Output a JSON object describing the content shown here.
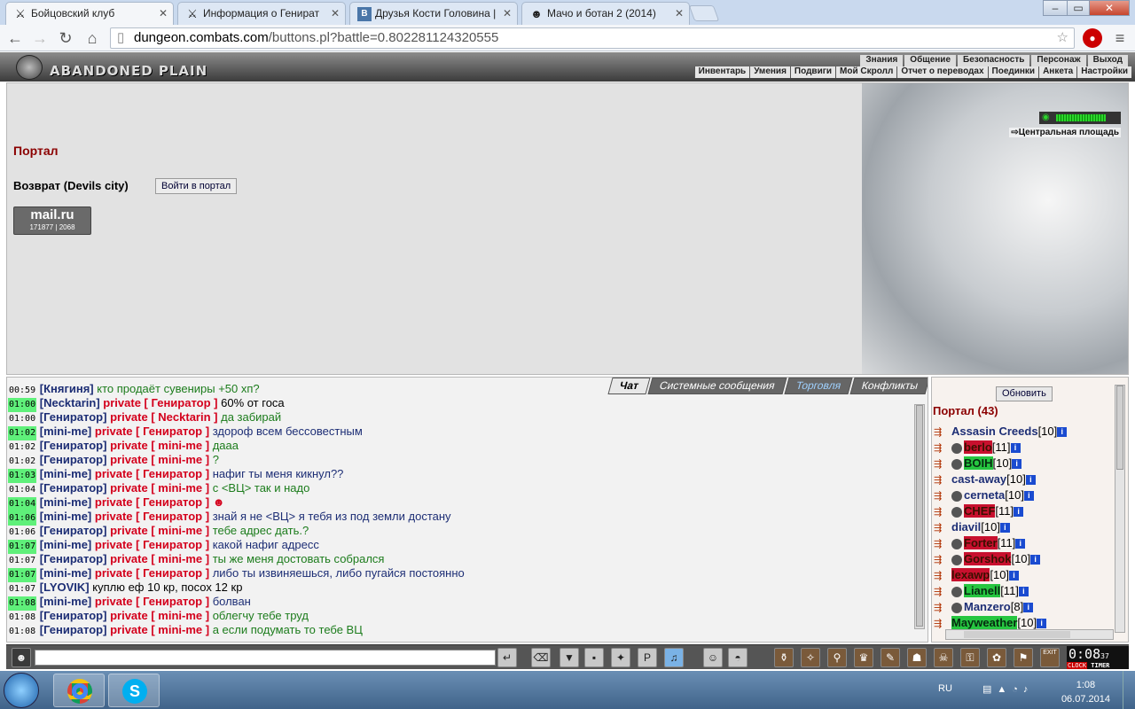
{
  "browser": {
    "tabs": [
      {
        "title": "Бойцовский клуб",
        "icon": "crossed-swords-icon",
        "active": true
      },
      {
        "title": "Информация о Генират",
        "icon": "crossed-swords-icon",
        "active": false
      },
      {
        "title": "Друзья Кости Головина |",
        "icon": "vk-icon",
        "active": false
      },
      {
        "title": "Мачо и ботан 2 (2014)",
        "icon": "character-icon",
        "active": false
      }
    ],
    "url_host": "dungeon.combats.com",
    "url_path": "/buttons.pl?battle=0.802281124320555"
  },
  "game": {
    "logo": "ABANDONED PLAIN",
    "menu_top": [
      "Знания",
      "Общение",
      "Безопасность",
      "Персонаж",
      "Выход"
    ],
    "menu_bottom": [
      "Инвентарь",
      "Умения",
      "Подвиги",
      "Мой Скролл",
      "Отчет о переводах",
      "Поединки",
      "Анкета",
      "Настройки"
    ]
  },
  "main": {
    "portal_title": "Портал",
    "return_label": "Возврат (Devils city)",
    "enter_button": "Войти в портал",
    "mailru": {
      "logo": "mail.ru",
      "count1": "171877",
      "count2": "2068"
    },
    "hp_fill": 0.78,
    "location_link": "Центральная площадь"
  },
  "chat": {
    "tabs": [
      "Чат",
      "Системные сообщения",
      "Торговля",
      "Конфликты"
    ],
    "lines": [
      {
        "time": "00:59",
        "hl": false,
        "from": "Княгиня",
        "to": "",
        "text": "кто продаёт сувениры +50 хп?",
        "color": "g"
      },
      {
        "time": "01:00",
        "hl": true,
        "from": "Necktarin",
        "to": "Гениратор",
        "text": "60% от госа",
        "color": "k"
      },
      {
        "time": "01:00",
        "hl": false,
        "from": "Гениратор",
        "to": "Necktarin",
        "text": "да забирай",
        "color": "g"
      },
      {
        "time": "01:02",
        "hl": true,
        "from": "mini-me",
        "to": "Гениратор",
        "text": "здороф всем бессовестным",
        "color": "b"
      },
      {
        "time": "01:02",
        "hl": false,
        "from": "Гениратор",
        "to": "mini-me",
        "text": "дааа",
        "color": "g"
      },
      {
        "time": "01:02",
        "hl": false,
        "from": "Гениратор",
        "to": "mini-me",
        "text": "?",
        "color": "g"
      },
      {
        "time": "01:03",
        "hl": true,
        "from": "mini-me",
        "to": "Гениратор",
        "text": "нафиг ты меня кикнул??",
        "color": "b"
      },
      {
        "time": "01:04",
        "hl": false,
        "from": "Гениратор",
        "to": "mini-me",
        "text": "с <ВЦ> так и надо",
        "color": "g"
      },
      {
        "time": "01:04",
        "hl": true,
        "from": "mini-me",
        "to": "Гениратор",
        "text": "☻",
        "color": "r"
      },
      {
        "time": "01:06",
        "hl": true,
        "from": "mini-me",
        "to": "Гениратор",
        "text": "знай я не <ВЦ> я тебя из под земли достану",
        "color": "b"
      },
      {
        "time": "01:06",
        "hl": false,
        "from": "Гениратор",
        "to": "mini-me",
        "text": "тебе адрес дать.?",
        "color": "g"
      },
      {
        "time": "01:07",
        "hl": true,
        "from": "mini-me",
        "to": "Гениратор",
        "text": "какой нафиг адресс",
        "color": "b"
      },
      {
        "time": "01:07",
        "hl": false,
        "from": "Гениратор",
        "to": "mini-me",
        "text": "ты же меня достовать собрался",
        "color": "g"
      },
      {
        "time": "01:07",
        "hl": true,
        "from": "mini-me",
        "to": "Гениратор",
        "text": "либо ты извиняешься, либо пугайся постоянно",
        "color": "b"
      },
      {
        "time": "01:07",
        "hl": false,
        "from": "LYOVIK",
        "to": "",
        "text": "куплю еф 10 кр, посох 12 кр",
        "color": "k"
      },
      {
        "time": "01:08",
        "hl": true,
        "from": "mini-me",
        "to": "Гениратор",
        "text": "болван",
        "color": "b"
      },
      {
        "time": "01:08",
        "hl": false,
        "from": "Гениратор",
        "to": "mini-me",
        "text": "облегчу тебе труд",
        "color": "g"
      },
      {
        "time": "01:08",
        "hl": false,
        "from": "Гениратор",
        "to": "mini-me",
        "text": "а если подумать то тебе ВЦ",
        "color": "g"
      }
    ],
    "private_word": "private"
  },
  "online": {
    "refresh_button": "Обновить",
    "title": "Портал (43)",
    "players": [
      {
        "name": "Assasin Creeds",
        "level": "[10]",
        "style": ""
      },
      {
        "name": "berlo",
        "level": "[11]",
        "style": "red"
      },
      {
        "name": "BOIH",
        "level": "[10]",
        "style": "green"
      },
      {
        "name": "cast-away",
        "level": "[10]",
        "style": ""
      },
      {
        "name": "cerneta",
        "level": "[10]",
        "style": ""
      },
      {
        "name": "CHEF",
        "level": "[11]",
        "style": "red"
      },
      {
        "name": "diavil",
        "level": "[10]",
        "style": ""
      },
      {
        "name": "Forter",
        "level": "[11]",
        "style": "red"
      },
      {
        "name": "Gorshok",
        "level": "[10]",
        "style": "red"
      },
      {
        "name": "lexawp",
        "level": "[10]",
        "style": "red"
      },
      {
        "name": "Lianell",
        "level": "[11]",
        "style": "green"
      },
      {
        "name": "Manzero",
        "level": "[8]",
        "style": ""
      },
      {
        "name": "Mayweather",
        "level": "[10]",
        "style": "green"
      }
    ]
  },
  "bottombar": {
    "clock_time": "0:08",
    "clock_seconds": "37",
    "clock_label1": "CLOCK",
    "clock_label2": "TIMER",
    "exit_label": "EXIT"
  },
  "taskbar": {
    "lang": "RU",
    "time": "1:08",
    "date": "06.07.2014"
  }
}
